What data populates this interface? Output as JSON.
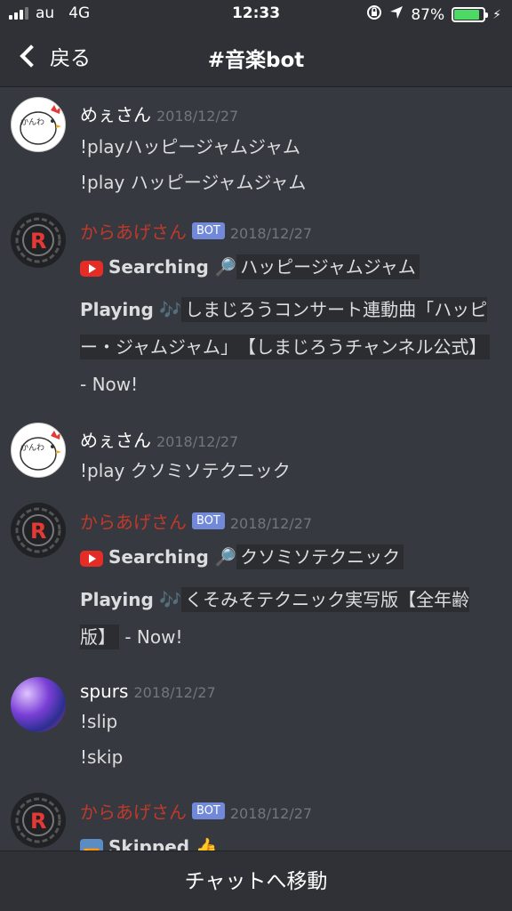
{
  "status_bar": {
    "carrier": "au",
    "network": "4G",
    "time": "12:33",
    "battery": "87%",
    "battery_level": 0.87
  },
  "nav": {
    "back_label": "戻る",
    "title": "#音楽bot"
  },
  "messages": [
    {
      "user": "めぇさん",
      "date": "2018/12/27",
      "lines": [
        "!playハッピージャムジャム",
        "!play ハッピージャムジャム"
      ]
    },
    {
      "user": "からあげさん",
      "badge": "BOT",
      "date": "2018/12/27",
      "searching_label": "Searching",
      "search_query": "ハッピージャムジャム",
      "playing_label": "Playing",
      "playing_title": "しまじろうコンサート連動曲「ハッピー・ジャムジャム」　【しまじろうチャンネル公式】",
      "status": "- Now!"
    },
    {
      "user": "めぇさん",
      "date": "2018/12/27",
      "lines": [
        "!play クソミソテクニック"
      ]
    },
    {
      "user": "からあげさん",
      "badge": "BOT",
      "date": "2018/12/27",
      "searching_label": "Searching",
      "search_query": "クソミソテクニック",
      "playing_label": "Playing",
      "playing_title": "くそみそテクニック実写版【全年齢版】",
      "status": "- Now!"
    },
    {
      "user": "spurs",
      "date": "2018/12/27",
      "lines": [
        "!slip",
        "!skip"
      ]
    },
    {
      "user": "からあげさん",
      "badge": "BOT",
      "date": "2018/12/27",
      "skipped_label": "Skipped"
    }
  ],
  "bottom_bar": {
    "label": "チャットへ移動"
  },
  "icons": {
    "search": "🔎",
    "music": "🎶",
    "thumbs_up": "👍"
  }
}
